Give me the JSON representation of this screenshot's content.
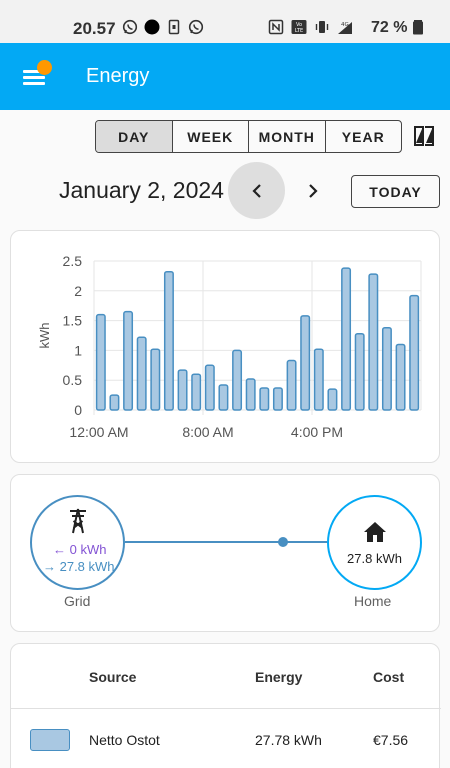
{
  "status_bar": {
    "time": "20.57",
    "battery": "72 %",
    "left_icons": [
      "whatsapp-icon",
      "record-dot-icon",
      "sim-icon",
      "whatsapp-icon"
    ],
    "right_icons": [
      "nfc-icon",
      "volte-icon",
      "vibrate-icon",
      "4g-signal-icon",
      "battery-icon"
    ]
  },
  "app_bar": {
    "title": "Energy",
    "badge_color": "#ff9800",
    "color": "#03a9f4"
  },
  "period_selector": {
    "options": [
      "DAY",
      "WEEK",
      "MONTH",
      "YEAR"
    ],
    "selected": "DAY"
  },
  "date_nav": {
    "date": "January 2, 2024",
    "prev": "‹",
    "next": "›",
    "today_label": "TODAY"
  },
  "chart_data": {
    "type": "bar",
    "ylabel": "kWh",
    "ylim": [
      0,
      2.5
    ],
    "yticks": [
      "0",
      "0.5",
      "1",
      "1.5",
      "2",
      "2.5"
    ],
    "xtick_labels": [
      "12:00 AM",
      "8:00 AM",
      "4:00 PM"
    ],
    "categories": [
      "0",
      "1",
      "2",
      "3",
      "4",
      "5",
      "6",
      "7",
      "8",
      "9",
      "10",
      "11",
      "12",
      "13",
      "14",
      "15",
      "16",
      "17",
      "18",
      "19",
      "20",
      "21",
      "22",
      "23"
    ],
    "values": [
      1.6,
      0.25,
      1.65,
      1.22,
      1.02,
      2.32,
      0.67,
      0.6,
      0.75,
      0.42,
      1.0,
      0.52,
      0.37,
      0.37,
      0.83,
      1.58,
      1.02,
      0.35,
      2.38,
      1.28,
      2.28,
      1.38,
      1.1,
      1.92
    ],
    "bar_color": "#a9c8e2",
    "bar_border": "#488fc2",
    "grid": true
  },
  "energy_flow": {
    "grid": {
      "label": "Grid",
      "icon": "transmission-tower-icon",
      "in": "← 0 kWh",
      "out": "→ 27.8 kWh"
    },
    "home": {
      "label": "Home",
      "icon": "home-icon",
      "value": "27.8 kWh"
    }
  },
  "sources_table": {
    "headers": [
      "Source",
      "Energy",
      "Cost"
    ],
    "rows": [
      {
        "source": "Netto Ostot",
        "energy": "27.78 kWh",
        "cost": "€7.56",
        "color": "#a9c8e2"
      }
    ]
  }
}
